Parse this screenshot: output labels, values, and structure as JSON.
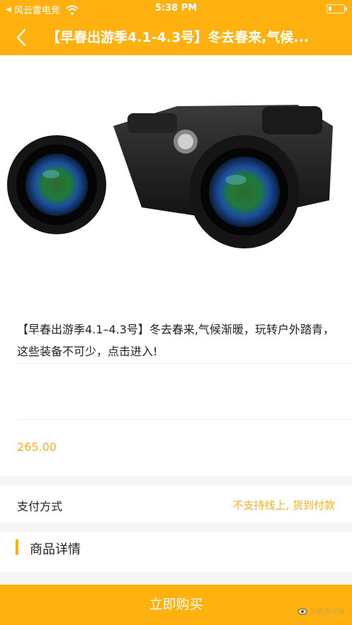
{
  "status_bar": {
    "carrier": "风云雷电竞",
    "time": "5:38 PM"
  },
  "nav": {
    "title": "【早春出游季4.1-4.3号】冬去春来,气候..."
  },
  "product": {
    "description": "【早春出游季4.1–4.3号】冬去春来,气候渐暖，玩转户外踏青，这些装备不可少，点击进入!",
    "price": "265.00"
  },
  "payment": {
    "label": "支付方式",
    "value": "不支持线上, 货到付款"
  },
  "details": {
    "title": "商品详情"
  },
  "buy": {
    "label": "立即购买"
  },
  "watermark": {
    "text": "风鹤游戏网"
  },
  "colors": {
    "accent": "#ffb20f",
    "price": "#ffae20"
  },
  "icons": {
    "back": "chevron-left-icon",
    "wifi": "wifi-icon",
    "battery": "battery-icon"
  }
}
